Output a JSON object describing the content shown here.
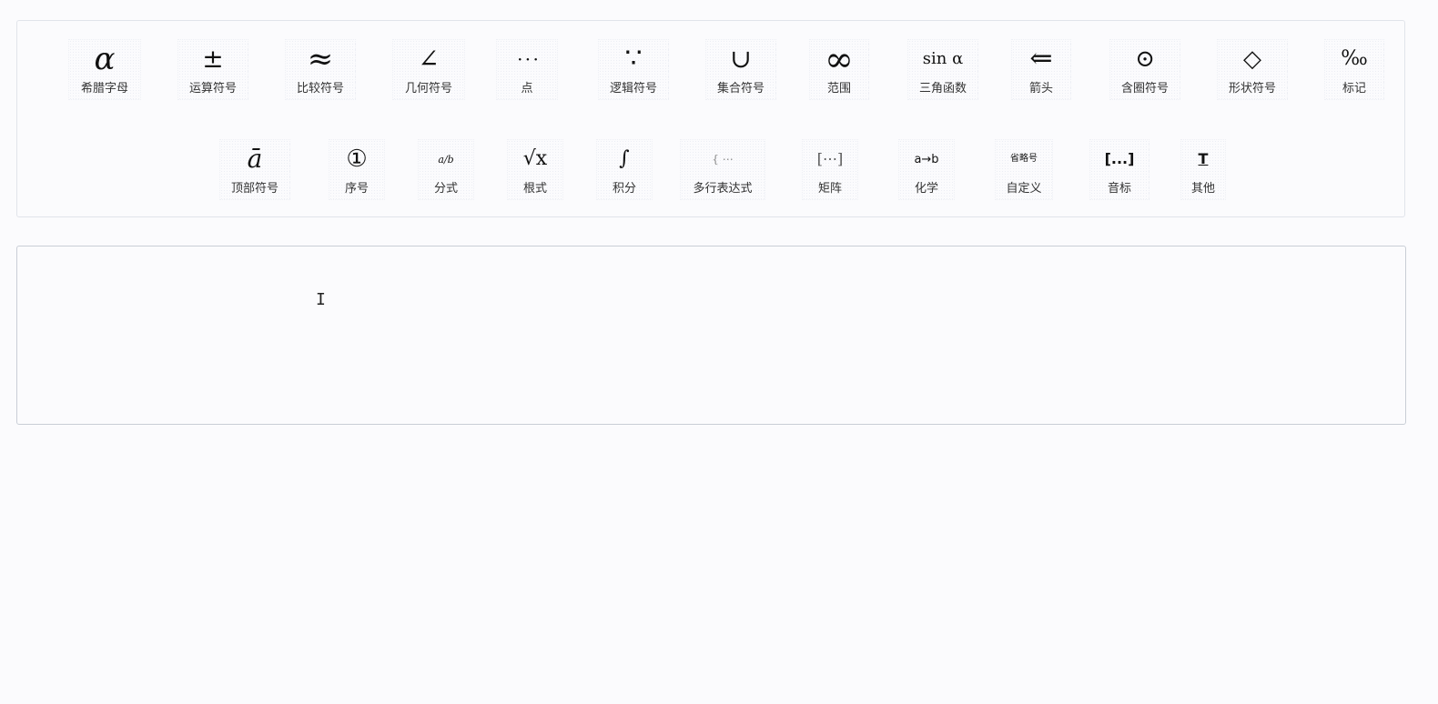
{
  "toolbar": {
    "row1": [
      {
        "label": "希腊字母",
        "glyph": "α",
        "icon": "alpha-icon"
      },
      {
        "label": "运算符号",
        "glyph": "±",
        "icon": "plus-minus-icon"
      },
      {
        "label": "比较符号",
        "glyph": "≈",
        "icon": "approx-icon"
      },
      {
        "label": "几何符号",
        "glyph": "∠",
        "icon": "angle-icon"
      },
      {
        "label": "点",
        "glyph": "· · ·",
        "icon": "dots-icon"
      },
      {
        "label": "逻辑符号",
        "glyph": "∵",
        "icon": "because-icon"
      },
      {
        "label": "集合符号",
        "glyph": "∪",
        "icon": "union-icon"
      },
      {
        "label": "范围",
        "glyph": "∞",
        "icon": "infinity-icon"
      },
      {
        "label": "三角函数",
        "glyph": "sin α",
        "icon": "sine-icon"
      },
      {
        "label": "箭头",
        "glyph": "⇐",
        "icon": "left-double-arrow-icon"
      },
      {
        "label": "含圈符号",
        "glyph": "⊙",
        "icon": "circled-dot-icon"
      },
      {
        "label": "形状符号",
        "glyph": "◇",
        "icon": "diamond-icon"
      },
      {
        "label": "标记",
        "glyph": "‰",
        "icon": "per-mille-icon"
      }
    ],
    "row2": [
      {
        "label": "顶部符号",
        "glyph": "ā",
        "icon": "bar-a-icon"
      },
      {
        "label": "序号",
        "glyph": "①",
        "icon": "circled-one-icon"
      },
      {
        "label": "分式",
        "glyph": "a/b",
        "icon": "fraction-icon"
      },
      {
        "label": "根式",
        "glyph": "√x",
        "icon": "sqrt-icon"
      },
      {
        "label": "积分",
        "glyph": "∫",
        "icon": "integral-icon"
      },
      {
        "label": "多行表达式",
        "glyph": "{ ⋯",
        "icon": "multiline-expression-icon"
      },
      {
        "label": "矩阵",
        "glyph": "[⋯]",
        "icon": "matrix-icon"
      },
      {
        "label": "化学",
        "glyph": "a→b",
        "icon": "chemistry-arrow-icon"
      },
      {
        "label": "自定义",
        "glyph": "省略号",
        "icon": "custom-icon"
      },
      {
        "label": "音标",
        "glyph": "[...]",
        "icon": "phonetic-icon"
      },
      {
        "label": "其他",
        "glyph": "T",
        "icon": "other-text-icon"
      }
    ]
  },
  "editor": {
    "cursor_glyph": "I"
  }
}
